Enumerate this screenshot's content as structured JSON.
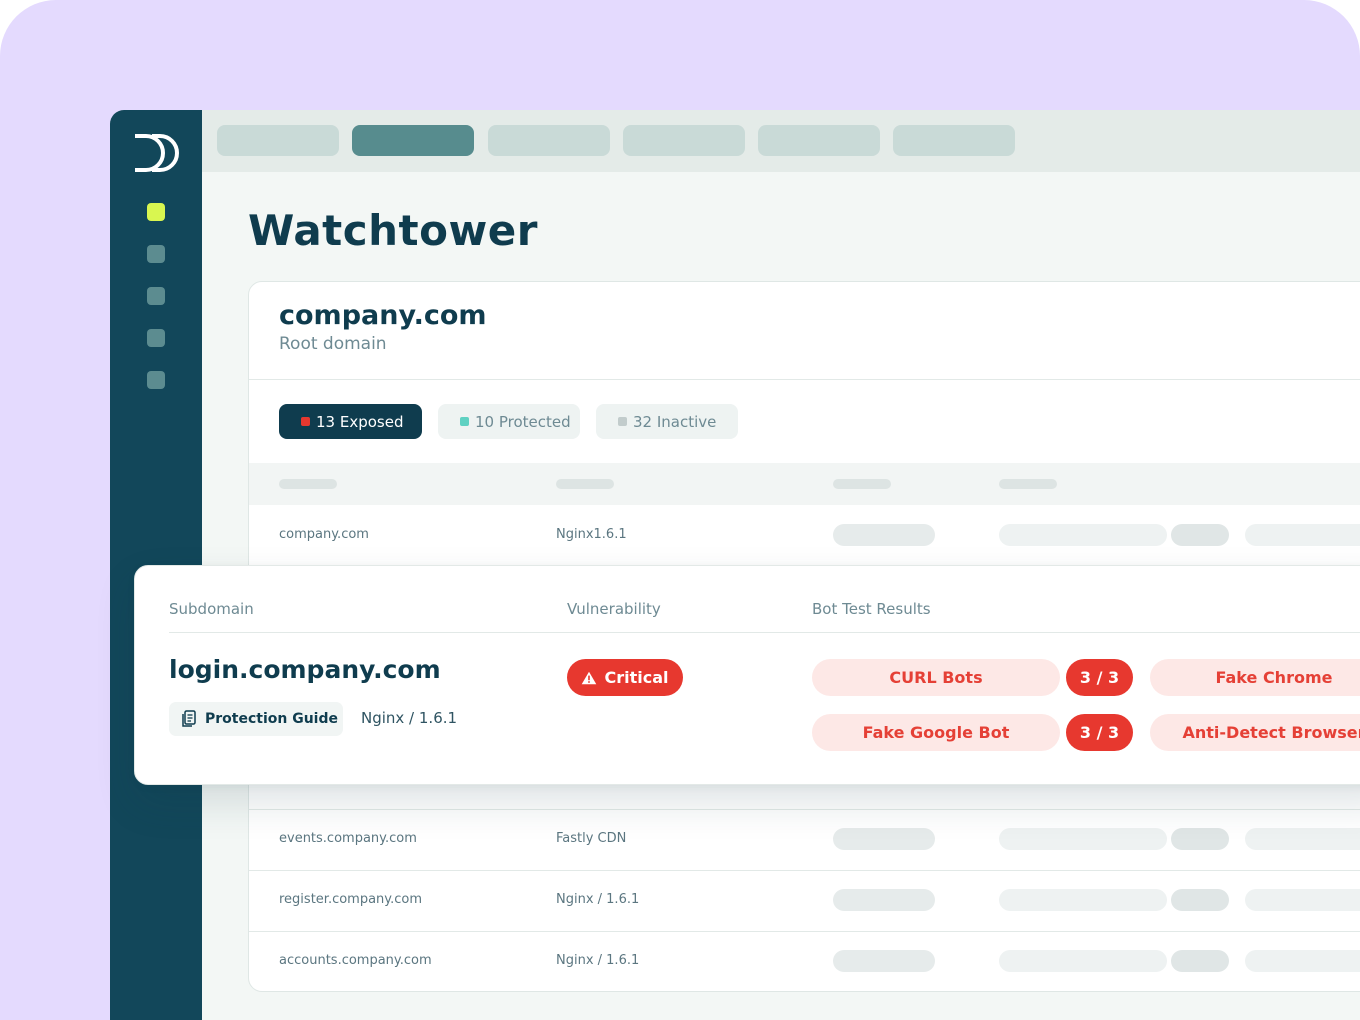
{
  "app": {
    "title": "Watchtower",
    "brand_color": "#12475a",
    "accent_color": "#d9f650",
    "critical_color": "#e7382f"
  },
  "root": {
    "domain": "company.com",
    "subtitle": "Root domain"
  },
  "filters": [
    {
      "label": "13 Exposed",
      "color": "#e7382f",
      "active": true
    },
    {
      "label": "10 Protected",
      "color": "#5fd1c2",
      "active": false
    },
    {
      "label": "32 Inactive",
      "color": "#c2cccc",
      "active": false
    }
  ],
  "rows": [
    {
      "subdomain": "company.com",
      "server": "Nginx1.6.1"
    },
    {
      "subdomain": "events.company.com",
      "server": "Fastly CDN"
    },
    {
      "subdomain": "register.company.com",
      "server": "Nginx / 1.6.1"
    },
    {
      "subdomain": "accounts.company.com",
      "server": "Nginx / 1.6.1"
    }
  ],
  "detail": {
    "headers": {
      "subdomain": "Subdomain",
      "vulnerability": "Vulnerability",
      "bot_tests": "Bot Test Results"
    },
    "subdomain": "login.company.com",
    "guide_label": "Protection Guide",
    "server": "Nginx / 1.6.1",
    "vulnerability": "Critical",
    "bot_tests": [
      {
        "name": "CURL Bots",
        "score": "3 / 3"
      },
      {
        "name": "Fake Chrome"
      },
      {
        "name": "Fake Google Bot",
        "score": "3 / 3"
      },
      {
        "name": "Anti-Detect Browser"
      }
    ]
  }
}
